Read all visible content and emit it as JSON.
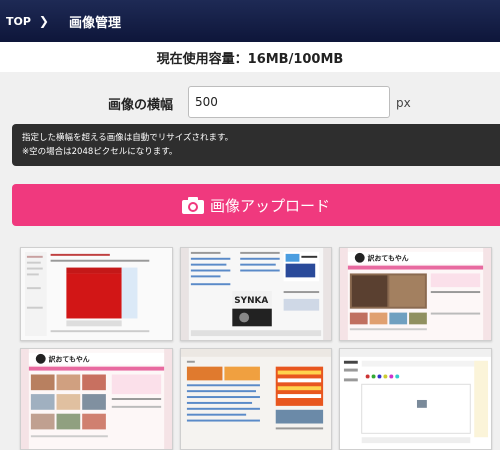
{
  "header": {
    "top_label": "TOP",
    "separator": "❯",
    "title": "画像管理"
  },
  "usage": {
    "text": "現在使用容量：16MB/100MB"
  },
  "width_setting": {
    "label": "画像の横幅",
    "value": "500",
    "unit": "px"
  },
  "note": {
    "line1": "指定した横幅を超える画像は自動でリサイズされます。",
    "line2": "※空の場合は2048ピクセルになります。"
  },
  "upload_button": {
    "label": "画像アップロード",
    "icon": "camera-icon",
    "color": "#f0397e"
  },
  "thumbnails": {
    "item1": {
      "logo": ""
    },
    "item2": {
      "logo": "SYNKA"
    },
    "item3": {
      "logo": "訳おてもやん"
    },
    "item4": {
      "logo": "訳おてもやん"
    },
    "item5": {
      "logo": ""
    },
    "item6": {
      "logo": ""
    }
  }
}
